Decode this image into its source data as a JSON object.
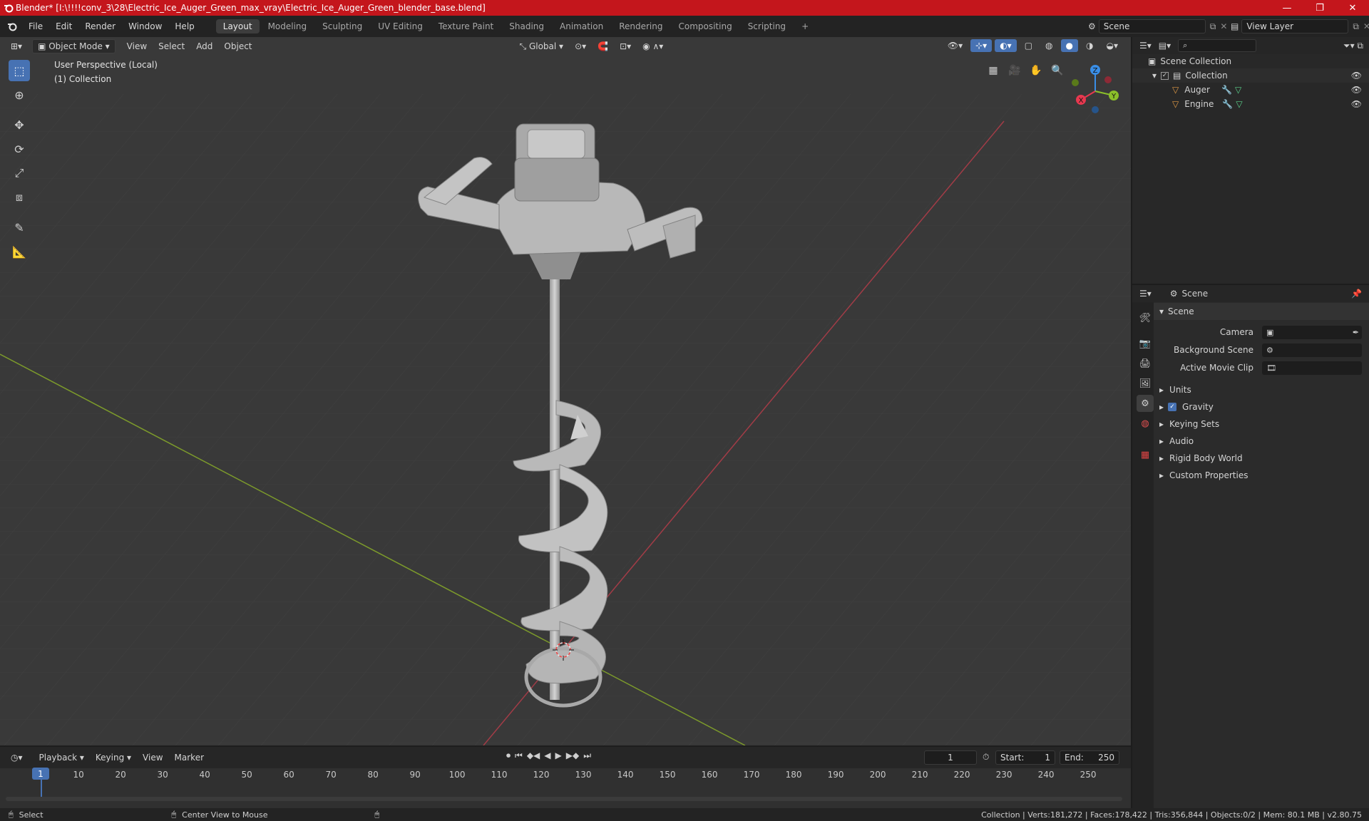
{
  "window": {
    "title": "Blender* [I:\\!!!!conv_3\\28\\Electric_Ice_Auger_Green_max_vray\\Electric_Ice_Auger_Green_blender_base.blend]",
    "minimize": "—",
    "maximize": "❐",
    "close": "✕"
  },
  "menu": {
    "file": "File",
    "edit": "Edit",
    "render": "Render",
    "window": "Window",
    "help": "Help"
  },
  "workspaces": [
    "Layout",
    "Modeling",
    "Sculpting",
    "UV Editing",
    "Texture Paint",
    "Shading",
    "Animation",
    "Rendering",
    "Compositing",
    "Scripting"
  ],
  "workspace_add": "+",
  "scene_name": "Scene",
  "view_layer": "View Layer",
  "viewport": {
    "mode": "Object Mode",
    "view": "View",
    "select": "Select",
    "add": "Add",
    "object": "Object",
    "orientation": "Global",
    "perspective": "User Perspective (Local)",
    "collection": "(1) Collection",
    "gizmo": {
      "x": "X",
      "y": "Y",
      "z": "Z"
    }
  },
  "outliner": {
    "scene_collection": "Scene Collection",
    "collection": "Collection",
    "objects": [
      "Auger",
      "Engine"
    ]
  },
  "properties": {
    "context": "Scene",
    "panel": "Scene",
    "camera_label": "Camera",
    "background_scene_label": "Background Scene",
    "active_movie_clip_label": "Active Movie Clip",
    "sections": [
      "Units",
      "Gravity",
      "Keying Sets",
      "Audio",
      "Rigid Body World",
      "Custom Properties"
    ]
  },
  "timeline": {
    "playback": "Playback",
    "keying": "Keying",
    "view": "View",
    "marker": "Marker",
    "current_frame": "1",
    "start_label": "Start:",
    "start": "1",
    "end_label": "End:",
    "end": "250",
    "ticks": [
      "1",
      "10",
      "20",
      "30",
      "40",
      "50",
      "60",
      "70",
      "80",
      "90",
      "100",
      "110",
      "120",
      "130",
      "140",
      "150",
      "160",
      "170",
      "180",
      "190",
      "200",
      "210",
      "220",
      "230",
      "240",
      "250"
    ]
  },
  "status": {
    "select": "Select",
    "center_view": "Center View to Mouse",
    "stats": "Collection | Verts:181,272 | Faces:178,422 | Tris:356,844 | Objects:0/2 | Mem: 80.1 MB | v2.80.75"
  },
  "colors": {
    "accent": "#4772b3",
    "titlebar": "#c4161c",
    "x_axis": "#e8384f",
    "y_axis": "#8bbf2a",
    "z_axis": "#3a8ee6"
  }
}
